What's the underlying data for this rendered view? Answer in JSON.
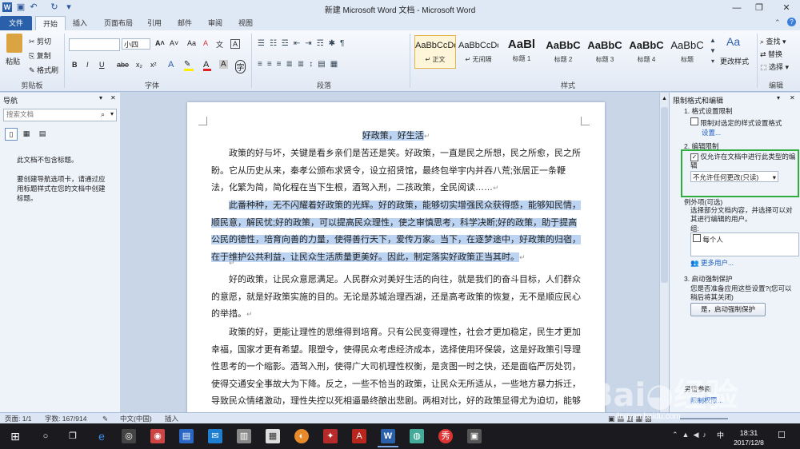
{
  "window": {
    "title": "新建 Microsoft Word 文档 - Microsoft Word",
    "controls": {
      "minimize": "—",
      "restore": "❐",
      "close": "✕"
    }
  },
  "tabs": [
    "文件",
    "开始",
    "插入",
    "页面布局",
    "引用",
    "邮件",
    "审阅",
    "视图"
  ],
  "ribbon": {
    "clipboard": {
      "paste": "粘贴",
      "cut": "剪切",
      "copy": "复制",
      "format_painter": "格式刷",
      "label": "剪贴板"
    },
    "font": {
      "name": "",
      "size": "小四",
      "label": "字体",
      "bold": "B",
      "italic": "I",
      "underline": "U",
      "strike": "abe",
      "sub": "x₂",
      "sup": "x²",
      "grow": "A˄",
      "shrink": "A˅",
      "case": "Aa",
      "clear": "A",
      "pinyin": "文",
      "border": "A"
    },
    "paragraph": {
      "label": "段落"
    },
    "styles": {
      "label": "样式",
      "items": [
        {
          "preview": "AaBbCcDd",
          "name": "↵ 正文"
        },
        {
          "preview": "AaBbCcDd",
          "name": "↵ 无间隔"
        },
        {
          "preview": "AaBl",
          "name": "标题 1"
        },
        {
          "preview": "AaBbC",
          "name": "标题 2"
        },
        {
          "preview": "AaBbC",
          "name": "标题 3"
        },
        {
          "preview": "AaBbC",
          "name": "标题 4"
        },
        {
          "preview": "AaBbC",
          "name": "标题"
        }
      ],
      "change_styles": "更改样式"
    },
    "editing": {
      "find": "查找 ▾",
      "replace": "替换",
      "select": "选择 ▾",
      "label": "编辑"
    }
  },
  "nav": {
    "title": "导航",
    "search_placeholder": "搜索文档",
    "no_headings": "此文档不包含标题。",
    "hint": "要创建导航选项卡，请通过应用标题样式在您的文档中创建标题。"
  },
  "document": {
    "title": "好政策，好生活",
    "paragraphs": [
      "政策的好与坏，关键是看乡亲们是苦还是笑。好政策，一直是民之所想，民之所愈，民之所盼。它从历史从来，秦孝公颁布求贤令，设立招贤馆，最终包举宇内并吞八荒;张居正一条鞭法，化繁为简，简化程在当下生根，酒驾入刑，二孩政策，全民阅读……",
      "此番种种，无不闪耀着好政策的光辉。好的政策，能够切实增强民众获得感，能够知民情，顺民意，解民忧;好的政策，可以提高民众理性，使之审慎思考，科学决断;好的政策，助于提高公民的德性，培育向善的力量，使得善行天下，爱传万家。当下，在逐梦途中，好政策的归宿，在于维护公共利益，让民众生活质量更美好。因此，制定落实好政策正当其时。",
      "",
      "好的政策，让民众意愿满足。人民群众对美好生活的向往，就是我们的奋斗目标，人们群众的意愿，就是好政策实施的目的。无论是苏城治理西湖，还是高考政策的恢复，无不是顺应民心的举措。",
      "",
      "政策的好，更能让理性的思维得到培育。只有公民变得理性，社会才更加稳定，民生才更加幸福，国家才更有希望。限塑令，使得民众考虑经济成本，选择使用环保袋，这是好政策引导理性思考的一个缩影。酒驾入刑，使得广大司机理性权衡，是贪图一时之快，还是面临严厉处罚，使得交通安全事故大为下降。反之，一些不恰当的政策，让民众无所适从，一些地方暴力拆迁，导致民众情绪激动，理性失控以死相逼最终酿出悲剧。两相对比，好的政策显得尤为迫切，能够让民众谨慎思考，趋于理性。"
    ]
  },
  "restrict": {
    "title": "限制格式和编辑",
    "s1": "1. 格式设置限制",
    "s1_check": "限制对选定的样式设置格式",
    "s1_link": "设置...",
    "s2": "2. 编辑限制",
    "s2_check": "仅允许在文档中进行此类型的编辑",
    "s2_select": "不允许任何更改(只读)",
    "exceptions_title": "例外项(可选)",
    "exceptions_text": "选择部分文档内容，并选择可以对其进行编辑的用户。",
    "group_label": "组:",
    "everyone": "每个人",
    "more_users": "更多用户...",
    "s3": "3. 启动强制保护",
    "s3_text": "您是否准备应用这些设置?(您可以稍后将其关闭)",
    "start_btn": "是，启动强制保护",
    "bottom1": "另请参阅",
    "bottom2": "限制权限..."
  },
  "status": {
    "page": "页面: 1/1",
    "words": "字数: 167/914",
    "lang": "中文(中国)",
    "mode": "插入"
  },
  "taskbar": {
    "time": "18:31",
    "date": "2017/12/8",
    "ime": "中",
    "watermark": "jingyan.baidu.com"
  }
}
